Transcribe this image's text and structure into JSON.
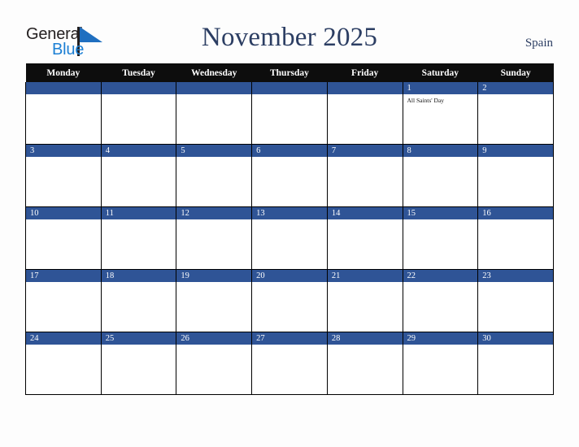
{
  "brand": {
    "name_part1": "General",
    "name_part2": "Blue",
    "triangle_color": "#1f6fc0",
    "text_color": "#231f20",
    "blue_color": "#1b7fd4"
  },
  "header": {
    "title": "November 2025",
    "locale": "Spain",
    "title_color": "#2c3e63"
  },
  "calendar": {
    "month": "November",
    "year": "2025",
    "country": "Spain",
    "first_day_of_week": "Monday",
    "accent_color": "#2f5496",
    "header_bg": "#0d0d0d",
    "weekday_headers": [
      "Monday",
      "Tuesday",
      "Wednesday",
      "Thursday",
      "Friday",
      "Saturday",
      "Sunday"
    ],
    "weeks": [
      [
        {
          "day": "",
          "events": []
        },
        {
          "day": "",
          "events": []
        },
        {
          "day": "",
          "events": []
        },
        {
          "day": "",
          "events": []
        },
        {
          "day": "",
          "events": []
        },
        {
          "day": "1",
          "events": [
            "All Saints' Day"
          ]
        },
        {
          "day": "2",
          "events": []
        }
      ],
      [
        {
          "day": "3",
          "events": []
        },
        {
          "day": "4",
          "events": []
        },
        {
          "day": "5",
          "events": []
        },
        {
          "day": "6",
          "events": []
        },
        {
          "day": "7",
          "events": []
        },
        {
          "day": "8",
          "events": []
        },
        {
          "day": "9",
          "events": []
        }
      ],
      [
        {
          "day": "10",
          "events": []
        },
        {
          "day": "11",
          "events": []
        },
        {
          "day": "12",
          "events": []
        },
        {
          "day": "13",
          "events": []
        },
        {
          "day": "14",
          "events": []
        },
        {
          "day": "15",
          "events": []
        },
        {
          "day": "16",
          "events": []
        }
      ],
      [
        {
          "day": "17",
          "events": []
        },
        {
          "day": "18",
          "events": []
        },
        {
          "day": "19",
          "events": []
        },
        {
          "day": "20",
          "events": []
        },
        {
          "day": "21",
          "events": []
        },
        {
          "day": "22",
          "events": []
        },
        {
          "day": "23",
          "events": []
        }
      ],
      [
        {
          "day": "24",
          "events": []
        },
        {
          "day": "25",
          "events": []
        },
        {
          "day": "26",
          "events": []
        },
        {
          "day": "27",
          "events": []
        },
        {
          "day": "28",
          "events": []
        },
        {
          "day": "29",
          "events": []
        },
        {
          "day": "30",
          "events": []
        }
      ]
    ]
  }
}
